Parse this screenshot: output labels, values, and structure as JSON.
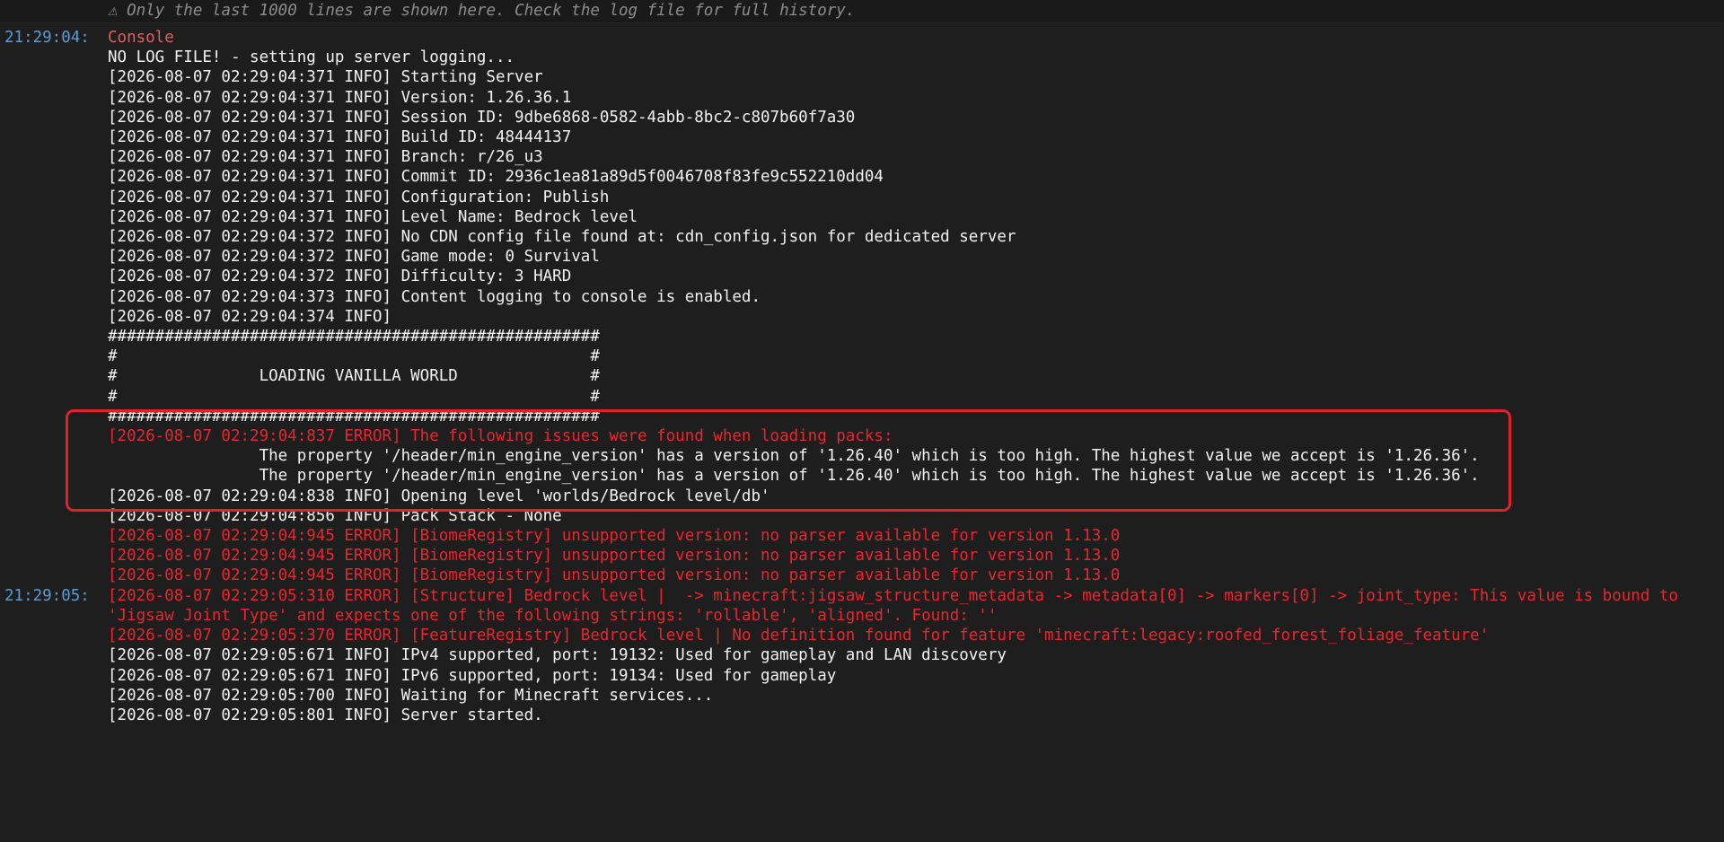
{
  "banner": {
    "icon": "warning-icon",
    "icon_glyph": "⚠",
    "text": "Only the last 1000 lines are shown here. Check the log file for full history."
  },
  "colors": {
    "background": "#1e1e1e",
    "timestamp": "#5b9bd5",
    "info_text": "#f2f2f2",
    "error_text": "#e8262d",
    "highlight_border": "#e4202a"
  },
  "log": {
    "groups": [
      {
        "time": "21:29:04:",
        "lines": [
          {
            "text": "Console",
            "level": "header"
          },
          {
            "text": "NO LOG FILE! - setting up server logging...",
            "level": "info"
          },
          {
            "text": "[2026-08-07 02:29:04:371 INFO] Starting Server",
            "level": "info"
          },
          {
            "text": "[2026-08-07 02:29:04:371 INFO] Version: 1.26.36.1",
            "level": "info"
          },
          {
            "text": "[2026-08-07 02:29:04:371 INFO] Session ID: 9dbe6868-0582-4abb-8bc2-c807b60f7a30",
            "level": "info"
          },
          {
            "text": "[2026-08-07 02:29:04:371 INFO] Build ID: 48444137",
            "level": "info"
          },
          {
            "text": "[2026-08-07 02:29:04:371 INFO] Branch: r/26_u3",
            "level": "info"
          },
          {
            "text": "[2026-08-07 02:29:04:371 INFO] Commit ID: 2936c1ea81a89d5f0046708f83fe9c552210dd04",
            "level": "info"
          },
          {
            "text": "[2026-08-07 02:29:04:371 INFO] Configuration: Publish",
            "level": "info"
          },
          {
            "text": "[2026-08-07 02:29:04:371 INFO] Level Name: Bedrock level",
            "level": "info"
          },
          {
            "text": "[2026-08-07 02:29:04:372 INFO] No CDN config file found at: cdn_config.json for dedicated server",
            "level": "info"
          },
          {
            "text": "[2026-08-07 02:29:04:372 INFO] Game mode: 0 Survival",
            "level": "info"
          },
          {
            "text": "[2026-08-07 02:29:04:372 INFO] Difficulty: 3 HARD",
            "level": "info"
          },
          {
            "text": "[2026-08-07 02:29:04:373 INFO] Content logging to console is enabled.",
            "level": "info"
          },
          {
            "text": "[2026-08-07 02:29:04:374 INFO]",
            "level": "info"
          },
          {
            "text": "####################################################",
            "level": "info"
          },
          {
            "text": "#                                                  #",
            "level": "info"
          },
          {
            "text": "#               LOADING VANILLA WORLD              #",
            "level": "info"
          },
          {
            "text": "#                                                  #",
            "level": "info"
          },
          {
            "text": "####################################################",
            "level": "info"
          },
          {
            "text": "[2026-08-07 02:29:04:837 ERROR] The following issues were found when loading packs:",
            "level": "error"
          },
          {
            "text": "                The property '/header/min_engine_version' has a version of '1.26.40' which is too high. The highest value we accept is '1.26.36'.",
            "level": "info"
          },
          {
            "text": "                The property '/header/min_engine_version' has a version of '1.26.40' which is too high. The highest value we accept is '1.26.36'.",
            "level": "info"
          },
          {
            "text": "[2026-08-07 02:29:04:838 INFO] Opening level 'worlds/Bedrock level/db'",
            "level": "info"
          },
          {
            "text": "[2026-08-07 02:29:04:856 INFO] Pack Stack - None",
            "level": "info"
          },
          {
            "text": "[2026-08-07 02:29:04:945 ERROR] [BiomeRegistry] unsupported version: no parser available for version 1.13.0",
            "level": "error"
          },
          {
            "text": "[2026-08-07 02:29:04:945 ERROR] [BiomeRegistry] unsupported version: no parser available for version 1.13.0",
            "level": "error"
          },
          {
            "text": "[2026-08-07 02:29:04:945 ERROR] [BiomeRegistry] unsupported version: no parser available for version 1.13.0",
            "level": "error"
          }
        ]
      },
      {
        "time": "21:29:05:",
        "lines": [
          {
            "text": "[2026-08-07 02:29:05:310 ERROR] [Structure] Bedrock level |  -> minecraft:jigsaw_structure_metadata -> metadata[0] -> markers[0] -> joint_type: This value is bound to 'Jigsaw Joint Type' and expects one of the following strings: 'rollable', 'aligned'. Found: ''",
            "level": "error"
          },
          {
            "text": "[2026-08-07 02:29:05:370 ERROR] [FeatureRegistry] Bedrock level | No definition found for feature 'minecraft:legacy:roofed_forest_foliage_feature'",
            "level": "error"
          },
          {
            "text": "[2026-08-07 02:29:05:671 INFO] IPv4 supported, port: 19132: Used for gameplay and LAN discovery",
            "level": "info"
          },
          {
            "text": "[2026-08-07 02:29:05:671 INFO] IPv6 supported, port: 19134: Used for gameplay",
            "level": "info"
          },
          {
            "text": "[2026-08-07 02:29:05:700 INFO] Waiting for Minecraft services...",
            "level": "info"
          },
          {
            "text": "[2026-08-07 02:29:05:801 INFO] Server started.",
            "level": "info"
          }
        ]
      }
    ]
  }
}
